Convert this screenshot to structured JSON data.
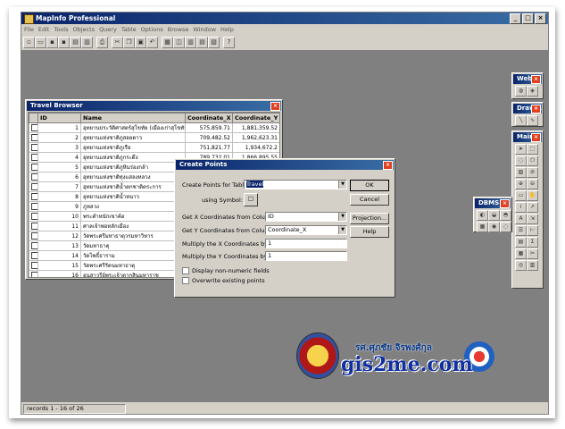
{
  "app": {
    "title": "MapInfo Professional"
  },
  "menu": [
    "File",
    "Edit",
    "Tools",
    "Objects",
    "Query",
    "Table",
    "Options",
    "Browse",
    "Window",
    "Help"
  ],
  "toolbar": {
    "icons": [
      "new-icon",
      "open-icon",
      "save-icon",
      "save-copy-icon",
      "open-workspace-icon",
      "save-workspace-icon",
      "print-icon",
      "cut-icon",
      "copy-icon",
      "paste-icon",
      "undo-icon",
      "new-browser-icon",
      "new-mapper-icon",
      "new-grapher-icon",
      "new-layout-icon",
      "new-redistrict-icon",
      "help-icon"
    ],
    "help_label": "?"
  },
  "browser": {
    "title": "Travel Browser",
    "columns": [
      "ID",
      "Name",
      "Coordinate_X",
      "Coordinate_Y"
    ],
    "rows": [
      [
        "1",
        "อุทยานประวัติศาสตร์สุโขทัย (เมืองเก่าสุโขทัย)",
        "575,859.71",
        "1,881,359.52"
      ],
      [
        "2",
        "อุทยานแห่งชาติภูสอยดาว",
        "709,482.52",
        "1,962,623.31"
      ],
      [
        "3",
        "อุทยานแห่งชาติภูเรือ",
        "751,821.77",
        "1,934,672.2"
      ],
      [
        "4",
        "อุทยานแห่งชาติภูกระดึง",
        "789,732.01",
        "1,866,895.55"
      ],
      [
        "5",
        "อุทยานแห่งชาติภูหินร่องกล้า",
        "",
        ""
      ],
      [
        "6",
        "อุทยานแห่งชาติทุ่งแสลงหลวง",
        "",
        ""
      ],
      [
        "7",
        "อุทยานแห่งชาติน้ำตกชาติตระการ",
        "",
        ""
      ],
      [
        "8",
        "อุทยานแห่งชาติน้ำหนาว",
        "",
        ""
      ],
      [
        "9",
        "ภูหลวง",
        "",
        ""
      ],
      [
        "10",
        "พระตำหนักเขาค้อ",
        "",
        ""
      ],
      [
        "11",
        "ศาลเจ้าพ่อหลักเมือง",
        "",
        ""
      ],
      [
        "12",
        "วัดพระศรีมหาธาตุวรมหาวิหาร",
        "",
        ""
      ],
      [
        "13",
        "วัดมหาธาตุ",
        "",
        ""
      ],
      [
        "14",
        "วัดโพธิ์ธาราม",
        "",
        ""
      ],
      [
        "15",
        "วัดพระศรีรัตนมหาธาตุ",
        "",
        ""
      ],
      [
        "16",
        "อนุสาวรีย์พระเจ้าตากสินมหาราช",
        "",
        ""
      ]
    ]
  },
  "dialog": {
    "title": "Create Points",
    "create_label": "Create Points for Table:",
    "create_value": "Travel",
    "symbol_label": "using Symbol:",
    "getx_label": "Get X Coordinates from Column:",
    "getx_value": "ID",
    "gety_label": "Get Y Coordinates from Column:",
    "gety_value": "Coordinate_X",
    "multx_label": "Multiply the X Coordinates by:",
    "multx_value": "1",
    "multy_label": "Multiply the Y Coordinates by:",
    "multy_value": "1",
    "display_label": "Display non-numeric fields",
    "overwrite_label": "Overwrite existing points",
    "ok": "OK",
    "cancel": "Cancel",
    "projection": "Projection...",
    "help": "Help"
  },
  "palettes": {
    "web": "Web S...",
    "drawing": "Drawi...",
    "main": "Main",
    "dbms": "DBMS"
  },
  "status": {
    "records": "records 1 - 16 of 26"
  },
  "watermark": {
    "thai": "รศ.ศุภชัย จิรพงศ์กุล",
    "site": "gis2me.com"
  }
}
